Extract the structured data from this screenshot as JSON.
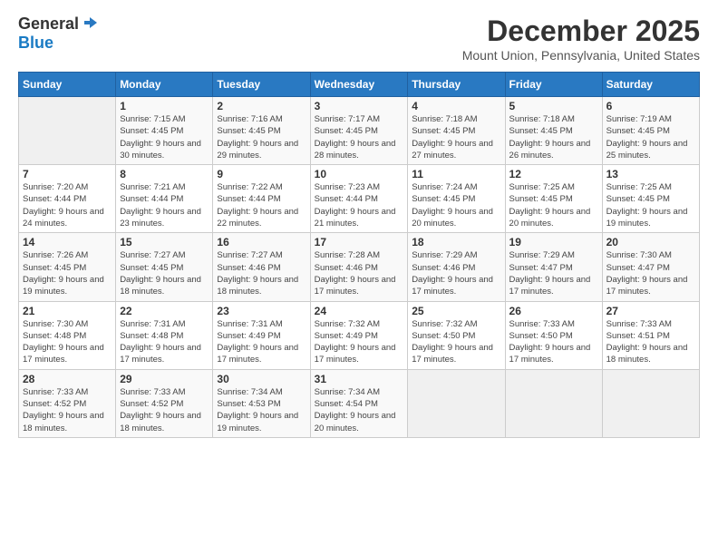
{
  "logo": {
    "general": "General",
    "blue": "Blue"
  },
  "title": "December 2025",
  "location": "Mount Union, Pennsylvania, United States",
  "days_header": [
    "Sunday",
    "Monday",
    "Tuesday",
    "Wednesday",
    "Thursday",
    "Friday",
    "Saturday"
  ],
  "weeks": [
    [
      {
        "day": "",
        "sunrise": "",
        "sunset": "",
        "daylight": ""
      },
      {
        "day": "1",
        "sunrise": "Sunrise: 7:15 AM",
        "sunset": "Sunset: 4:45 PM",
        "daylight": "Daylight: 9 hours and 30 minutes."
      },
      {
        "day": "2",
        "sunrise": "Sunrise: 7:16 AM",
        "sunset": "Sunset: 4:45 PM",
        "daylight": "Daylight: 9 hours and 29 minutes."
      },
      {
        "day": "3",
        "sunrise": "Sunrise: 7:17 AM",
        "sunset": "Sunset: 4:45 PM",
        "daylight": "Daylight: 9 hours and 28 minutes."
      },
      {
        "day": "4",
        "sunrise": "Sunrise: 7:18 AM",
        "sunset": "Sunset: 4:45 PM",
        "daylight": "Daylight: 9 hours and 27 minutes."
      },
      {
        "day": "5",
        "sunrise": "Sunrise: 7:18 AM",
        "sunset": "Sunset: 4:45 PM",
        "daylight": "Daylight: 9 hours and 26 minutes."
      },
      {
        "day": "6",
        "sunrise": "Sunrise: 7:19 AM",
        "sunset": "Sunset: 4:45 PM",
        "daylight": "Daylight: 9 hours and 25 minutes."
      }
    ],
    [
      {
        "day": "7",
        "sunrise": "Sunrise: 7:20 AM",
        "sunset": "Sunset: 4:44 PM",
        "daylight": "Daylight: 9 hours and 24 minutes."
      },
      {
        "day": "8",
        "sunrise": "Sunrise: 7:21 AM",
        "sunset": "Sunset: 4:44 PM",
        "daylight": "Daylight: 9 hours and 23 minutes."
      },
      {
        "day": "9",
        "sunrise": "Sunrise: 7:22 AM",
        "sunset": "Sunset: 4:44 PM",
        "daylight": "Daylight: 9 hours and 22 minutes."
      },
      {
        "day": "10",
        "sunrise": "Sunrise: 7:23 AM",
        "sunset": "Sunset: 4:44 PM",
        "daylight": "Daylight: 9 hours and 21 minutes."
      },
      {
        "day": "11",
        "sunrise": "Sunrise: 7:24 AM",
        "sunset": "Sunset: 4:45 PM",
        "daylight": "Daylight: 9 hours and 20 minutes."
      },
      {
        "day": "12",
        "sunrise": "Sunrise: 7:25 AM",
        "sunset": "Sunset: 4:45 PM",
        "daylight": "Daylight: 9 hours and 20 minutes."
      },
      {
        "day": "13",
        "sunrise": "Sunrise: 7:25 AM",
        "sunset": "Sunset: 4:45 PM",
        "daylight": "Daylight: 9 hours and 19 minutes."
      }
    ],
    [
      {
        "day": "14",
        "sunrise": "Sunrise: 7:26 AM",
        "sunset": "Sunset: 4:45 PM",
        "daylight": "Daylight: 9 hours and 19 minutes."
      },
      {
        "day": "15",
        "sunrise": "Sunrise: 7:27 AM",
        "sunset": "Sunset: 4:45 PM",
        "daylight": "Daylight: 9 hours and 18 minutes."
      },
      {
        "day": "16",
        "sunrise": "Sunrise: 7:27 AM",
        "sunset": "Sunset: 4:46 PM",
        "daylight": "Daylight: 9 hours and 18 minutes."
      },
      {
        "day": "17",
        "sunrise": "Sunrise: 7:28 AM",
        "sunset": "Sunset: 4:46 PM",
        "daylight": "Daylight: 9 hours and 17 minutes."
      },
      {
        "day": "18",
        "sunrise": "Sunrise: 7:29 AM",
        "sunset": "Sunset: 4:46 PM",
        "daylight": "Daylight: 9 hours and 17 minutes."
      },
      {
        "day": "19",
        "sunrise": "Sunrise: 7:29 AM",
        "sunset": "Sunset: 4:47 PM",
        "daylight": "Daylight: 9 hours and 17 minutes."
      },
      {
        "day": "20",
        "sunrise": "Sunrise: 7:30 AM",
        "sunset": "Sunset: 4:47 PM",
        "daylight": "Daylight: 9 hours and 17 minutes."
      }
    ],
    [
      {
        "day": "21",
        "sunrise": "Sunrise: 7:30 AM",
        "sunset": "Sunset: 4:48 PM",
        "daylight": "Daylight: 9 hours and 17 minutes."
      },
      {
        "day": "22",
        "sunrise": "Sunrise: 7:31 AM",
        "sunset": "Sunset: 4:48 PM",
        "daylight": "Daylight: 9 hours and 17 minutes."
      },
      {
        "day": "23",
        "sunrise": "Sunrise: 7:31 AM",
        "sunset": "Sunset: 4:49 PM",
        "daylight": "Daylight: 9 hours and 17 minutes."
      },
      {
        "day": "24",
        "sunrise": "Sunrise: 7:32 AM",
        "sunset": "Sunset: 4:49 PM",
        "daylight": "Daylight: 9 hours and 17 minutes."
      },
      {
        "day": "25",
        "sunrise": "Sunrise: 7:32 AM",
        "sunset": "Sunset: 4:50 PM",
        "daylight": "Daylight: 9 hours and 17 minutes."
      },
      {
        "day": "26",
        "sunrise": "Sunrise: 7:33 AM",
        "sunset": "Sunset: 4:50 PM",
        "daylight": "Daylight: 9 hours and 17 minutes."
      },
      {
        "day": "27",
        "sunrise": "Sunrise: 7:33 AM",
        "sunset": "Sunset: 4:51 PM",
        "daylight": "Daylight: 9 hours and 18 minutes."
      }
    ],
    [
      {
        "day": "28",
        "sunrise": "Sunrise: 7:33 AM",
        "sunset": "Sunset: 4:52 PM",
        "daylight": "Daylight: 9 hours and 18 minutes."
      },
      {
        "day": "29",
        "sunrise": "Sunrise: 7:33 AM",
        "sunset": "Sunset: 4:52 PM",
        "daylight": "Daylight: 9 hours and 18 minutes."
      },
      {
        "day": "30",
        "sunrise": "Sunrise: 7:34 AM",
        "sunset": "Sunset: 4:53 PM",
        "daylight": "Daylight: 9 hours and 19 minutes."
      },
      {
        "day": "31",
        "sunrise": "Sunrise: 7:34 AM",
        "sunset": "Sunset: 4:54 PM",
        "daylight": "Daylight: 9 hours and 20 minutes."
      },
      {
        "day": "",
        "sunrise": "",
        "sunset": "",
        "daylight": ""
      },
      {
        "day": "",
        "sunrise": "",
        "sunset": "",
        "daylight": ""
      },
      {
        "day": "",
        "sunrise": "",
        "sunset": "",
        "daylight": ""
      }
    ]
  ]
}
